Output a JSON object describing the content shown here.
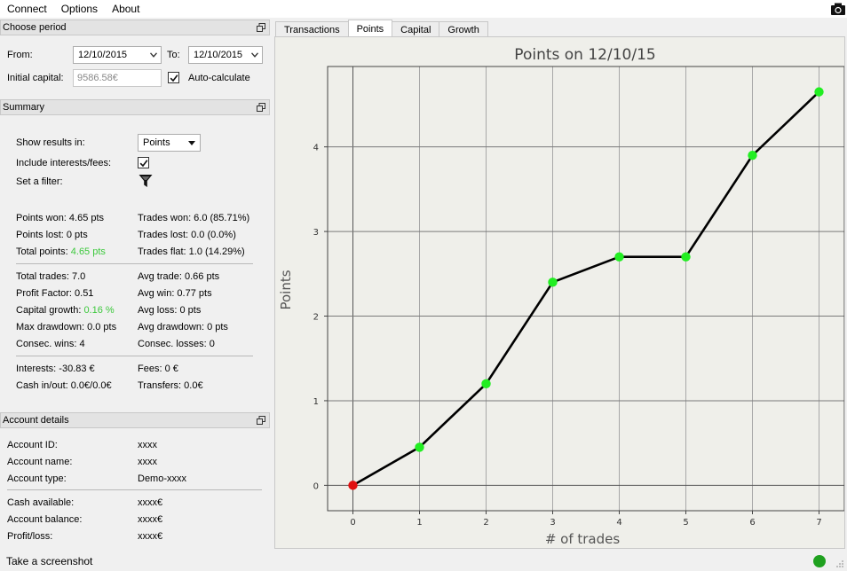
{
  "menu": {
    "items": [
      "Connect",
      "Options",
      "About"
    ]
  },
  "panels": {
    "period": {
      "title": "Choose period",
      "from_label": "From:",
      "from_value": "12/10/2015",
      "to_label": "To:",
      "to_value": "12/10/2015",
      "initial_capital_label": "Initial capital:",
      "initial_capital_value": "9586.58€",
      "auto_calc_label": "Auto-calculate",
      "auto_calc_checked": true
    },
    "summary": {
      "title": "Summary",
      "show_results_label": "Show results in:",
      "show_results_value": "Points",
      "include_interests_label": "Include interests/fees:",
      "include_interests_checked": true,
      "filter_label": "Set a filter:",
      "points_won": "Points won: 4.65 pts",
      "points_lost": "Points lost: 0 pts",
      "total_points_label": "Total points:",
      "total_points_value": "4.65 pts",
      "trades_won": "Trades won: 6.0 (85.71%)",
      "trades_lost": "Trades lost: 0.0 (0.0%)",
      "trades_flat": "Trades flat: 1.0 (14.29%)",
      "total_trades": "Total trades: 7.0",
      "profit_factor": "Profit Factor: 0.51",
      "capital_growth_label": "Capital growth:",
      "capital_growth_value": "0.16 %",
      "max_drawdown": "Max drawdown: 0.0 pts",
      "consec_wins": "Consec. wins: 4",
      "avg_trade": "Avg trade: 0.66 pts",
      "avg_win": "Avg win: 0.77 pts",
      "avg_loss": "Avg loss: 0 pts",
      "avg_drawdown": "Avg drawdown: 0 pts",
      "consec_losses": "Consec. losses: 0",
      "interests": "Interests: -30.83 €",
      "cash_inout": "Cash in/out: 0.0€/0.0€",
      "fees": "Fees: 0 €",
      "transfers": "Transfers: 0.0€"
    },
    "account": {
      "title": "Account details",
      "id_label": "Account ID:",
      "id_value": "xxxx",
      "name_label": "Account name:",
      "name_value": "xxxx",
      "type_label": "Account type:",
      "type_value": "Demo-xxxx",
      "cash_label": "Cash available:",
      "cash_value": "xxxx€",
      "balance_label": "Account balance:",
      "balance_value": "xxxx€",
      "pl_label": "Profit/loss:",
      "pl_value": "xxxx€"
    }
  },
  "tabs": [
    "Transactions",
    "Points",
    "Capital",
    "Growth"
  ],
  "active_tab": "Points",
  "status": {
    "screenshot_label": "Take a screenshot",
    "connection_color": "#1fa11f"
  },
  "icons": {
    "camera": "camera-icon",
    "filter": "funnel-icon",
    "float": "float-window-icon"
  },
  "chart_data": {
    "type": "line",
    "title": "Points on 12/10/15",
    "xlabel": "# of trades",
    "ylabel": "Points",
    "x": [
      0,
      1,
      2,
      3,
      4,
      5,
      6,
      7
    ],
    "y": [
      0,
      0.45,
      1.2,
      2.4,
      2.7,
      2.7,
      3.9,
      4.65
    ],
    "point_colors": [
      "#e01010",
      "#22ee22",
      "#22ee22",
      "#22ee22",
      "#22ee22",
      "#22ee22",
      "#22ee22",
      "#22ee22"
    ],
    "xlim": [
      -0.38,
      7.38
    ],
    "ylim": [
      -0.3,
      4.95
    ],
    "xticks": [
      0,
      1,
      2,
      3,
      4,
      5,
      6,
      7
    ],
    "yticks": [
      0,
      1,
      2,
      3,
      4
    ],
    "grid": true
  }
}
